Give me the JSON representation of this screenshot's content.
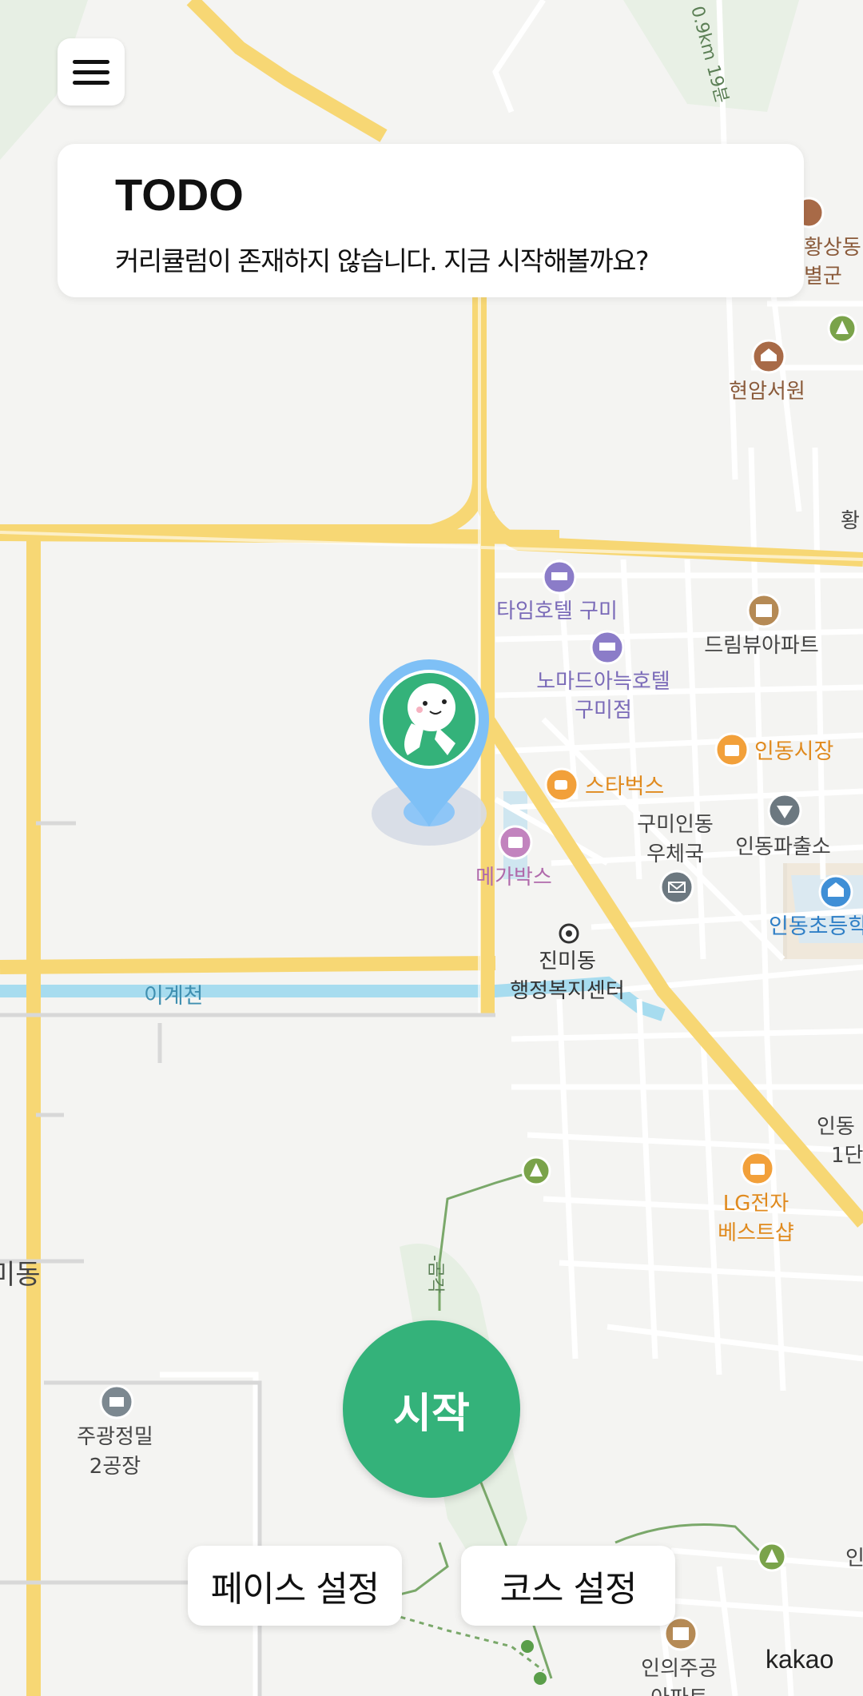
{
  "menu": {
    "icon": "hamburger-menu-icon"
  },
  "todo": {
    "title": "TODO",
    "message": "커리큘럼이 존재하지 않습니다. 지금 시작해볼까요?"
  },
  "actions": {
    "start_label": "시작",
    "pace_label": "페이스 설정",
    "course_label": "코스 설정"
  },
  "map": {
    "attribution": "kakao",
    "trail_label": "0.9km 19분",
    "trail_label_2": "-곰각",
    "stream_label": "이계천",
    "places": [
      {
        "name": "현암서원",
        "icon": "landmark-icon"
      },
      {
        "name": "타임호텔 구미",
        "icon": "hotel-icon"
      },
      {
        "name": "노마드아늑호텔",
        "name2": "구미점",
        "icon": "hotel-icon"
      },
      {
        "name": "드림뷰아파트",
        "icon": "apartment-icon"
      },
      {
        "name": "인동시장",
        "icon": "shopping-icon"
      },
      {
        "name": "스타벅스",
        "icon": "cafe-icon"
      },
      {
        "name": "구미인동",
        "name2": "우체국",
        "icon": "post-office-icon"
      },
      {
        "name": "인동파출소",
        "icon": "police-icon"
      },
      {
        "name": "메가박스",
        "icon": "cinema-icon"
      },
      {
        "name": "인동초등학",
        "icon": "school-icon"
      },
      {
        "name": "진미동",
        "name2": "행정복지센터",
        "icon": "government-office-icon"
      },
      {
        "name": "LG전자",
        "name2": "베스트샵",
        "icon": "shopping-icon"
      },
      {
        "name": "주광정밀",
        "name2": "2공장",
        "icon": "factory-icon"
      },
      {
        "name": "인의주공",
        "name2": "아파트",
        "icon": "apartment-icon"
      }
    ],
    "partial_labels": {
      "top_right_1": "황상동",
      "top_right_2": "별군",
      "right_1": "황",
      "right_2": "인동",
      "right_3": "1단",
      "left": "미동",
      "bottom_right": "인"
    }
  },
  "user_marker": {
    "icon": "runner-location-pin-icon"
  },
  "colors": {
    "accent": "#34b27a",
    "road": "#f7d774",
    "water": "#a7dcef",
    "map_bg": "#f4f4f2"
  }
}
